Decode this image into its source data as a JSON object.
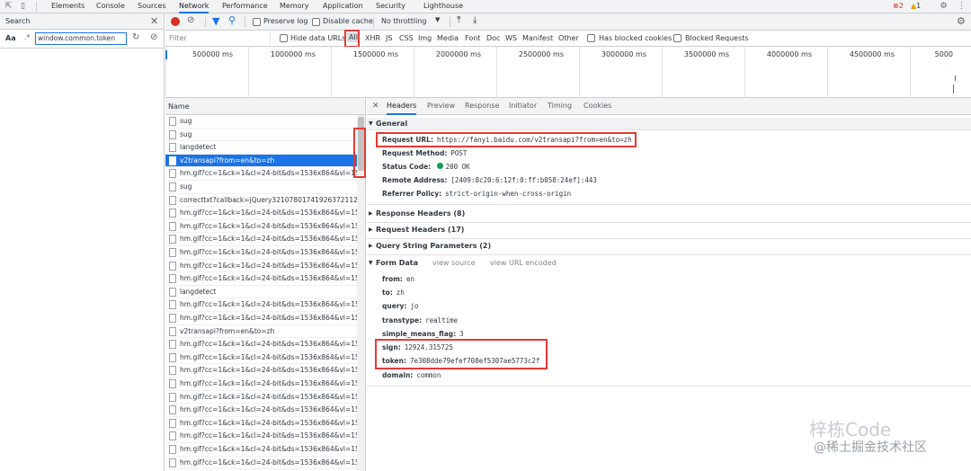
{
  "topbar": {
    "tabs": [
      "Elements",
      "Console",
      "Sources",
      "Network",
      "Performance",
      "Memory",
      "Application",
      "Security",
      "Lighthouse"
    ],
    "active_tab": "Network",
    "errors": "2",
    "warnings": "1"
  },
  "search": {
    "title": "Search",
    "match_case": "Aa",
    "regex": ".*",
    "query": "window.common.token"
  },
  "network": {
    "preserve_log": "Preserve log",
    "disable_cache": "Disable cache",
    "throttling": "No throttling",
    "filter_placeholder": "Filter",
    "hide_data_urls": "Hide data URLs",
    "types": [
      "All",
      "XHR",
      "JS",
      "CSS",
      "Img",
      "Media",
      "Font",
      "Doc",
      "WS",
      "Manifest",
      "Other"
    ],
    "has_blocked_cookies": "Has blocked cookies",
    "blocked_requests": "Blocked Requests",
    "timeline_labels": [
      "500000 ms",
      "1000000 ms",
      "1500000 ms",
      "2000000 ms",
      "2500000 ms",
      "3000000 ms",
      "3500000 ms",
      "4000000 ms",
      "4500000 ms",
      "5000"
    ],
    "name_header": "Name"
  },
  "requests": [
    "sug",
    "sug",
    "langdetect",
    "v2transapi?from=en&to=zh",
    "hm.gif?cc=1&ck=1&cl=24-bit&ds=1536x864&vl=15",
    "sug",
    "correcttxt?callback=jQuery32107801741926372112_1",
    "hm.gif?cc=1&ck=1&cl=24-bit&ds=1536x864&vl=15",
    "hm.gif?cc=1&ck=1&cl=24-bit&ds=1536x864&vl=15",
    "hm.gif?cc=1&ck=1&cl=24-bit&ds=1536x864&vl=15",
    "hm.gif?cc=1&ck=1&cl=24-bit&ds=1536x864&vl=15",
    "hm.gif?cc=1&ck=1&cl=24-bit&ds=1536x864&vl=15",
    "hm.gif?cc=1&ck=1&cl=24-bit&ds=1536x864&vl=15",
    "langdetect",
    "hm.gif?cc=1&ck=1&cl=24-bit&ds=1536x864&vl=15",
    "hm.gif?cc=1&ck=1&cl=24-bit&ds=1536x864&vl=15",
    "v2transapi?from=en&to=zh",
    "hm.gif?cc=1&ck=1&cl=24-bit&ds=1536x864&vl=15",
    "hm.gif?cc=1&ck=1&cl=24-bit&ds=1536x864&vl=15",
    "hm.gif?cc=1&ck=1&cl=24-bit&ds=1536x864&vl=15",
    "hm.gif?cc=1&ck=1&cl=24-bit&ds=1536x864&vl=15",
    "hm.gif?cc=1&ck=1&cl=24-bit&ds=1536x864&vl=15",
    "hm.gif?cc=1&ck=1&cl=24-bit&ds=1536x864&vl=15",
    "hm.gif?cc=1&ck=1&cl=24-bit&ds=1536x864&vl=15",
    "hm.gif?cc=1&ck=1&cl=24-bit&ds=1536x864&vl=15",
    "hm.gif?cc=1&ck=1&cl=24-bit&ds=1536x864&vl=15",
    "hm.gif?cc=1&ck=1&cl=24-bit&ds=1536x864&vl=15"
  ],
  "selected_request": 3,
  "details": {
    "tabs": [
      "Headers",
      "Preview",
      "Response",
      "Initiator",
      "Timing",
      "Cookies"
    ],
    "active_tab": "Headers",
    "general_title": "General",
    "general": [
      {
        "key": "Request URL:",
        "value": "https://fanyi.baidu.com/v2transapi?from=en&to=zh"
      },
      {
        "key": "Request Method:",
        "value": "POST"
      },
      {
        "key": "Status Code:",
        "value": "200 OK"
      },
      {
        "key": "Remote Address:",
        "value": "[2409:8c20:6:12f:0:ff:b058:24ef]:443"
      },
      {
        "key": "Referrer Policy:",
        "value": "strict-origin-when-cross-origin"
      }
    ],
    "sections": [
      "Response Headers (8)",
      "Request Headers (17)",
      "Query String Parameters (2)"
    ],
    "form_data_title": "Form Data",
    "view_source": "view source",
    "view_url_encoded": "view URL encoded",
    "form_data": [
      {
        "key": "from:",
        "value": "en"
      },
      {
        "key": "to:",
        "value": "zh"
      },
      {
        "key": "query:",
        "value": "jo"
      },
      {
        "key": "transtype:",
        "value": "realtime"
      },
      {
        "key": "simple_means_flag:",
        "value": "3"
      },
      {
        "key": "sign:",
        "value": "12924.315725"
      },
      {
        "key": "token:",
        "value": "7e308dde79efef708ef5307ae5773c2f"
      },
      {
        "key": "domain:",
        "value": "common"
      }
    ]
  },
  "watermark": {
    "line1": "梓栋Code",
    "line2": "@稀土掘金技术社区"
  },
  "colors": {
    "accent": "#1a73e8",
    "highlight": "#e53935",
    "record": "#d93025",
    "status_ok": "#0f9d58"
  }
}
